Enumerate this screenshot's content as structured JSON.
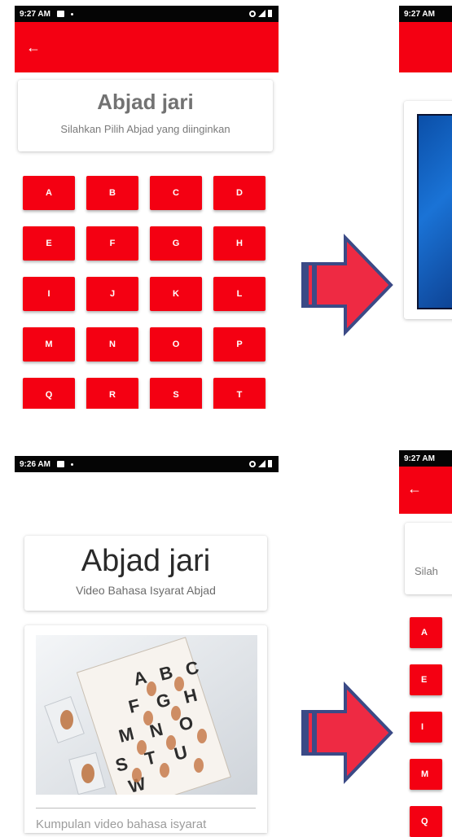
{
  "panel_top_left": {
    "status": {
      "time": "9:27 AM"
    },
    "header": {
      "title": "Abjad jari",
      "subtitle": "Silahkan Pilih Abjad yang diinginkan"
    },
    "letters": [
      "A",
      "B",
      "C",
      "D",
      "E",
      "F",
      "G",
      "H",
      "I",
      "J",
      "K",
      "L",
      "M",
      "N",
      "O",
      "P",
      "Q",
      "R",
      "S",
      "T"
    ]
  },
  "panel_top_right": {
    "status": {
      "time": "9:27 AM"
    }
  },
  "panel_bottom_left": {
    "status": {
      "time": "9:26 AM"
    },
    "header": {
      "title": "Abjad jari",
      "subtitle": "Video Bahasa Isyarat Abjad"
    },
    "card": {
      "caption": "Kumpulan video bahasa isyarat"
    }
  },
  "panel_bottom_right": {
    "status": {
      "time": "9:27 AM"
    },
    "header": {
      "subtitle": "Silah"
    },
    "letters": [
      "A",
      "E",
      "I",
      "M",
      "Q"
    ]
  },
  "colors": {
    "accent": "#f40012",
    "arrow_fill": "#ee2a43",
    "arrow_outline": "#3b4a86"
  },
  "icons": [
    "back-arrow-icon",
    "photo-notification-icon",
    "signal-icon",
    "battery-icon",
    "key-icon",
    "flow-arrow-icon"
  ]
}
